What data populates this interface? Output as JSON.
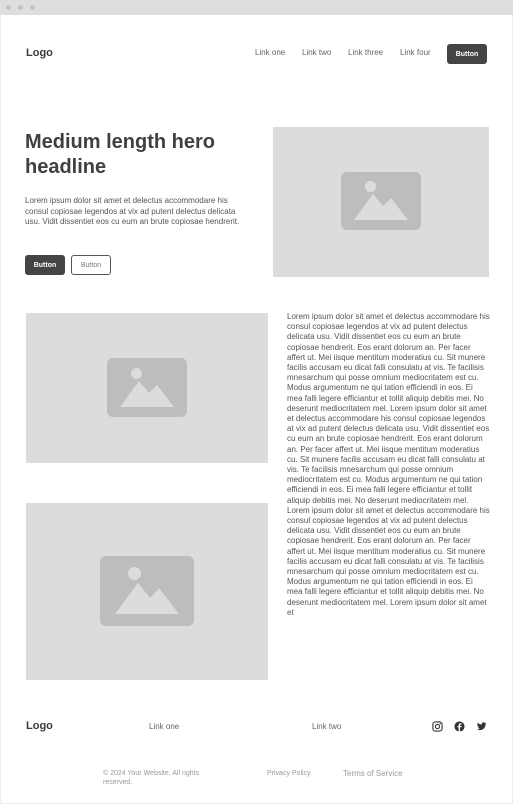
{
  "header": {
    "logo": "Logo",
    "links": [
      "Link one",
      "Link two",
      "Link three",
      "Link four"
    ],
    "button": "Button"
  },
  "hero": {
    "title": "Medium length hero headline",
    "text": "Lorem ipsum dolor sit amet et delectus accommodare his consul copiosae legendos at vix ad putent delectus delicata usu. Vidit dissentiet eos cu eum an brute copiosae hendrerit.",
    "primary_button": "Button",
    "secondary_button": "Button"
  },
  "content": {
    "body": "Lorem ipsum dolor sit amet et delectus accommodare his consul copiosae legendos at vix ad putent delectus delicata usu. Vidit dissentiet eos cu eum an brute copiosae hendrerit. Eos erant dolorum an. Per facer affert ut. Mei iisque mentitum moderatius cu. Sit munere facilis accusam eu dicat falli consulatu at vis. Te facilisis mnesarchum qui posse omnium mediocritatem est cu. Modus argumentum ne qui tation efficiendi in eos. Ei mea falli legere efficiantur et tollit aliquip debitis mei. No deserunt mediocritatem mel. Lorem ipsum dolor sit amet et delectus accommodare his consul copiosae legendos at vix ad putent delectus delicata usu. Vidit dissentiet eos cu eum an brute copiosae hendrerit. Eos erant dolorum an. Per facer affert ut. Mei iisque mentitum moderatius cu. Sit munere facilis accusam eu dicat falli consulatu at vis. Te facilisis mnesarchum qui posse omnium mediocritatem est cu. Modus argumentum ne qui tation efficiendi in eos. Ei mea falli legere efficiantur et tollit aliquip debitis mei. No deserunt mediocritatem mel. Lorem ipsum dolor sit amet et delectus accommodare his consul copiosae legendos at vix ad putent delectus delicata usu. Vidit dissentiet eos cu eum an brute copiosae hendrerit. Eos erant dolorum an. Per facer affert ut. Mei iisque mentitum moderatius cu. Sit munere facilis accusam eu dicat falli consulatu at vis. Te facilisis mnesarchum qui posse omnium mediocritatem est cu. Modus argumentum ne qui tation efficiendi in eos. Ei mea falli legere efficiantur et tollit aliquip debitis mei. No deserunt mediocritatem mel. Lorem ipsum dolor sit amet et"
  },
  "footer": {
    "logo": "Logo",
    "links": [
      "Link one",
      "Link two"
    ],
    "social_icons": [
      "instagram-icon",
      "facebook-icon",
      "twitter-icon"
    ],
    "copyright": "© 2024 Your Website. All rights reserved.",
    "privacy": "Privacy Policy",
    "terms": "Terms of Service"
  },
  "colors": {
    "dark": "#444444",
    "placeholder": "#dcdcdc",
    "icon": "#bdbdbd"
  }
}
